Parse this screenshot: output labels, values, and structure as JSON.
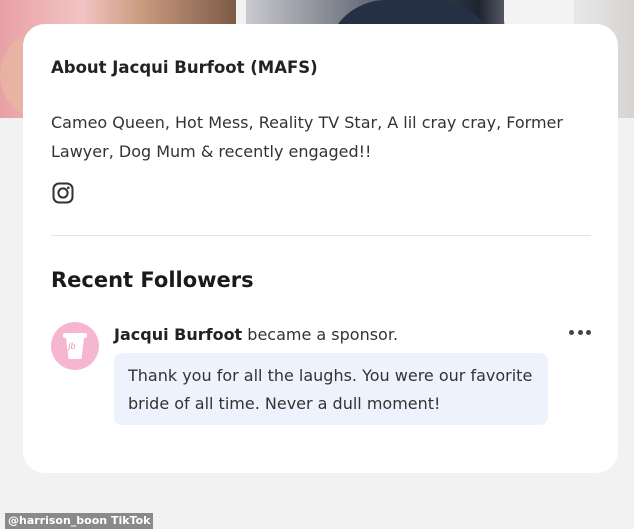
{
  "about": {
    "title": "About Jacqui Burfoot (MAFS)",
    "bio": "Cameo Queen, Hot Mess, Reality TV Star, A lil cray cray, Former Lawyer, Dog Mum & recently engaged!!",
    "social_icon": "instagram-icon"
  },
  "followers": {
    "title": "Recent Followers",
    "items": [
      {
        "avatar_icon": "coffee-cup-logo",
        "avatar_text": "jb",
        "name": "Jacqui Burfoot",
        "action": " became a sponsor.",
        "message": "Thank you for all the laughs. You were our favorite bride of all time. Never a dull moment!"
      }
    ]
  },
  "credit": "@harrison_boon TikTok",
  "colors": {
    "card": "#ffffff",
    "avatar": "#f7b6cf",
    "message_bg": "#eef2fc",
    "page_bg": "#f2f2f2"
  }
}
